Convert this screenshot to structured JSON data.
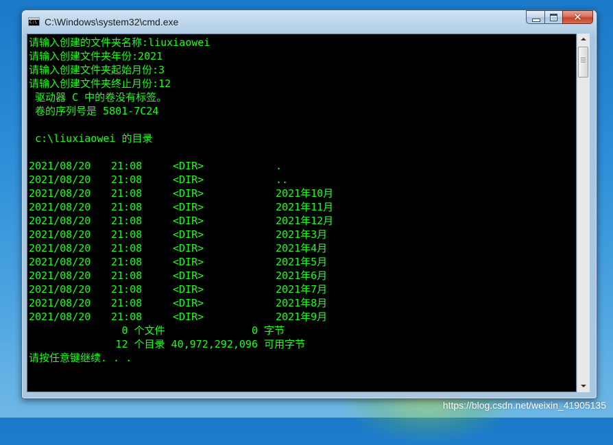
{
  "window": {
    "title": "C:\\Windows\\system32\\cmd.exe",
    "close_glyph": "✕"
  },
  "console": {
    "header_lines": [
      "请输入创建的文件夹名称:liuxiaowei",
      "请输入创建文件夹年份:2021",
      "请输入创建文件夹起始月份:3",
      "请输入创建文件夹终止月份:12",
      " 驱动器 C 中的卷没有标签。",
      " 卷的序列号是 5801-7C24",
      "",
      " c:\\liuxiaowei 的目录",
      ""
    ],
    "dir_entries": [
      {
        "date": "2021/08/20",
        "time": "21:08",
        "type": "<DIR>",
        "name": "."
      },
      {
        "date": "2021/08/20",
        "time": "21:08",
        "type": "<DIR>",
        "name": ".."
      },
      {
        "date": "2021/08/20",
        "time": "21:08",
        "type": "<DIR>",
        "name": "2021年10月"
      },
      {
        "date": "2021/08/20",
        "time": "21:08",
        "type": "<DIR>",
        "name": "2021年11月"
      },
      {
        "date": "2021/08/20",
        "time": "21:08",
        "type": "<DIR>",
        "name": "2021年12月"
      },
      {
        "date": "2021/08/20",
        "time": "21:08",
        "type": "<DIR>",
        "name": "2021年3月"
      },
      {
        "date": "2021/08/20",
        "time": "21:08",
        "type": "<DIR>",
        "name": "2021年4月"
      },
      {
        "date": "2021/08/20",
        "time": "21:08",
        "type": "<DIR>",
        "name": "2021年5月"
      },
      {
        "date": "2021/08/20",
        "time": "21:08",
        "type": "<DIR>",
        "name": "2021年6月"
      },
      {
        "date": "2021/08/20",
        "time": "21:08",
        "type": "<DIR>",
        "name": "2021年7月"
      },
      {
        "date": "2021/08/20",
        "time": "21:08",
        "type": "<DIR>",
        "name": "2021年8月"
      },
      {
        "date": "2021/08/20",
        "time": "21:08",
        "type": "<DIR>",
        "name": "2021年9月"
      }
    ],
    "footer_lines": [
      "               0 个文件              0 字节",
      "              12 个目录 40,972,292,096 可用字节",
      "请按任意键继续. . ."
    ],
    "text_color": "#19ff19",
    "background": "#000000"
  },
  "watermark": "https://blog.csdn.net/weixin_41905135"
}
